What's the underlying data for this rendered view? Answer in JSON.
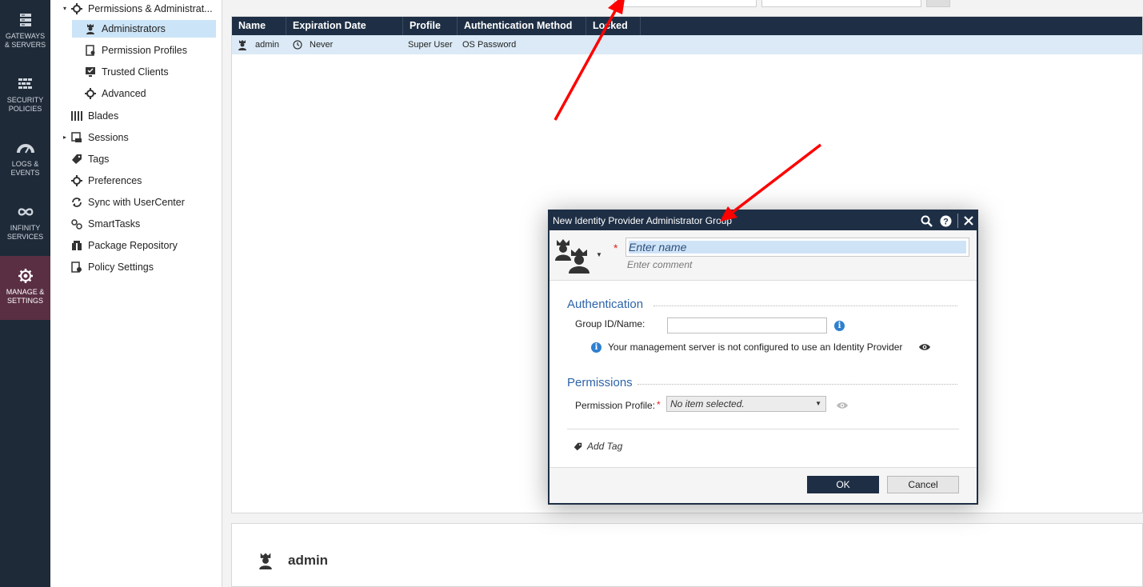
{
  "nav_rail": {
    "items": [
      {
        "label": "GATEWAYS & SERVERS",
        "icon": "servers-icon"
      },
      {
        "label": "SECURITY POLICIES",
        "icon": "firewall-icon"
      },
      {
        "label": "LOGS & EVENTS",
        "icon": "gauge-icon"
      },
      {
        "label": "INFINITY SERVICES",
        "icon": "infinity-icon"
      },
      {
        "label": "MANAGE & SETTINGS",
        "icon": "gear-icon"
      }
    ]
  },
  "tree": {
    "items": [
      {
        "label": "Permissions & Administrat...",
        "icon": "gear-icon"
      },
      {
        "label": "Administrators",
        "icon": "admin-icon"
      },
      {
        "label": "Permission Profiles",
        "icon": "profile-icon"
      },
      {
        "label": "Trusted Clients",
        "icon": "monitor-check-icon"
      },
      {
        "label": "Advanced",
        "icon": "gear-icon"
      },
      {
        "label": "Blades",
        "icon": "blades-icon"
      },
      {
        "label": "Sessions",
        "icon": "sessions-icon"
      },
      {
        "label": "Tags",
        "icon": "tag-icon"
      },
      {
        "label": "Preferences",
        "icon": "gear-icon"
      },
      {
        "label": "Sync with UserCenter",
        "icon": "sync-icon"
      },
      {
        "label": "SmartTasks",
        "icon": "gears-icon"
      },
      {
        "label": "Package Repository",
        "icon": "package-icon"
      },
      {
        "label": "Policy Settings",
        "icon": "policy-icon"
      }
    ]
  },
  "grid": {
    "columns": [
      "Name",
      "Expiration Date",
      "Profile",
      "Authentication Method",
      "Locked"
    ],
    "rows": [
      {
        "name": "admin",
        "expiration": "Never",
        "profile": "Super User",
        "auth": "OS Password",
        "locked": ""
      }
    ]
  },
  "details": {
    "name": "admin"
  },
  "dialog": {
    "title": "New Identity Provider Administrator Group",
    "name_placeholder": "Enter name",
    "comment_placeholder": "Enter comment",
    "authentication": {
      "title": "Authentication",
      "group_label": "Group ID/Name:",
      "group_value": "",
      "note": "Your management server is not configured to use an Identity Provider"
    },
    "permissions": {
      "title": "Permissions",
      "profile_label": "Permission Profile:",
      "profile_value": "No item selected."
    },
    "add_tag": "Add Tag",
    "ok": "OK",
    "cancel": "Cancel"
  },
  "colors": {
    "header_bg": "#1e2f45",
    "rail_bg": "#1e2a38",
    "rail_active": "#5a2f43",
    "selection": "#cce4f7",
    "accent": "#2d64a8",
    "annotation_arrow": "#ff0000"
  }
}
